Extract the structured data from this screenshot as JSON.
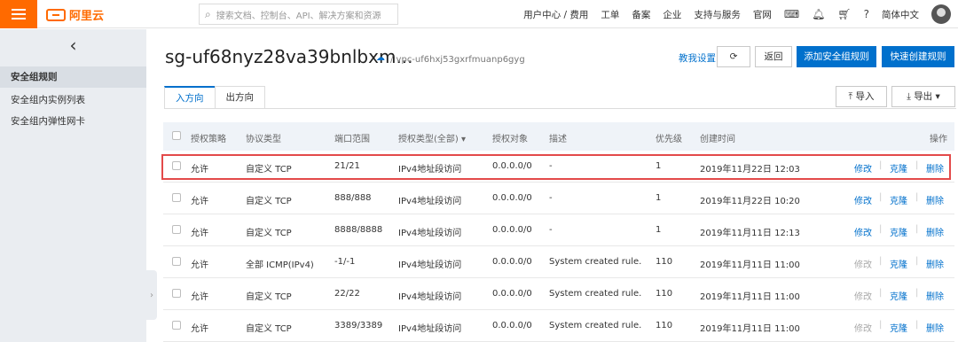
{
  "topbar": {
    "logo_text": "阿里云",
    "search_placeholder": "搜索文档、控制台、API、解决方案和资源",
    "nav": [
      "用户中心 / 费用",
      "工单",
      "备案",
      "企业",
      "支持与服务",
      "官网"
    ],
    "lang": "简体中文"
  },
  "sidebar": {
    "items": [
      "安全组规则",
      "安全组内实例列表",
      "安全组内弹性网卡"
    ]
  },
  "header": {
    "title": "sg-uf68nyz28va39bnlbxm...",
    "vpc": "/ vpc-uf6hxj53gxrfmuanp6gyg",
    "help_link": "教我设置",
    "back": "返回",
    "add_rule": "添加安全组规则",
    "quick_create": "快速创建规则",
    "import": "导入",
    "export": "导出"
  },
  "tabs": [
    "入方向",
    "出方向"
  ],
  "table": {
    "headers": {
      "policy": "授权策略",
      "protocol": "协议类型",
      "port": "端口范围",
      "auth_type": "授权类型(全部)",
      "target": "授权对象",
      "desc": "描述",
      "priority": "优先级",
      "time": "创建时间",
      "ops": "操作"
    },
    "actions": {
      "modify": "修改",
      "clone": "克隆",
      "delete": "删除"
    },
    "rows": [
      {
        "policy": "允许",
        "protocol": "自定义 TCP",
        "port": "21/21",
        "auth_type": "IPv4地址段访问",
        "target": "0.0.0.0/0",
        "desc": "-",
        "priority": "1",
        "time": "2019年11月22日 12:03",
        "modify_disabled": false
      },
      {
        "policy": "允许",
        "protocol": "自定义 TCP",
        "port": "888/888",
        "auth_type": "IPv4地址段访问",
        "target": "0.0.0.0/0",
        "desc": "-",
        "priority": "1",
        "time": "2019年11月22日 10:20",
        "modify_disabled": false
      },
      {
        "policy": "允许",
        "protocol": "自定义 TCP",
        "port": "8888/8888",
        "auth_type": "IPv4地址段访问",
        "target": "0.0.0.0/0",
        "desc": "-",
        "priority": "1",
        "time": "2019年11月11日 12:13",
        "modify_disabled": false
      },
      {
        "policy": "允许",
        "protocol": "全部 ICMP(IPv4)",
        "port": "-1/-1",
        "auth_type": "IPv4地址段访问",
        "target": "0.0.0.0/0",
        "desc": "System created rule.",
        "priority": "110",
        "time": "2019年11月11日 11:00",
        "modify_disabled": true
      },
      {
        "policy": "允许",
        "protocol": "自定义 TCP",
        "port": "22/22",
        "auth_type": "IPv4地址段访问",
        "target": "0.0.0.0/0",
        "desc": "System created rule.",
        "priority": "110",
        "time": "2019年11月11日 11:00",
        "modify_disabled": true
      },
      {
        "policy": "允许",
        "protocol": "自定义 TCP",
        "port": "3389/3389",
        "auth_type": "IPv4地址段访问",
        "target": "0.0.0.0/0",
        "desc": "System created rule.",
        "priority": "110",
        "time": "2019年11月11日 11:00",
        "modify_disabled": true
      }
    ]
  },
  "colors": {
    "brand": "#ff6a00",
    "accent": "#0070cc",
    "highlight": "#e34a4a"
  }
}
